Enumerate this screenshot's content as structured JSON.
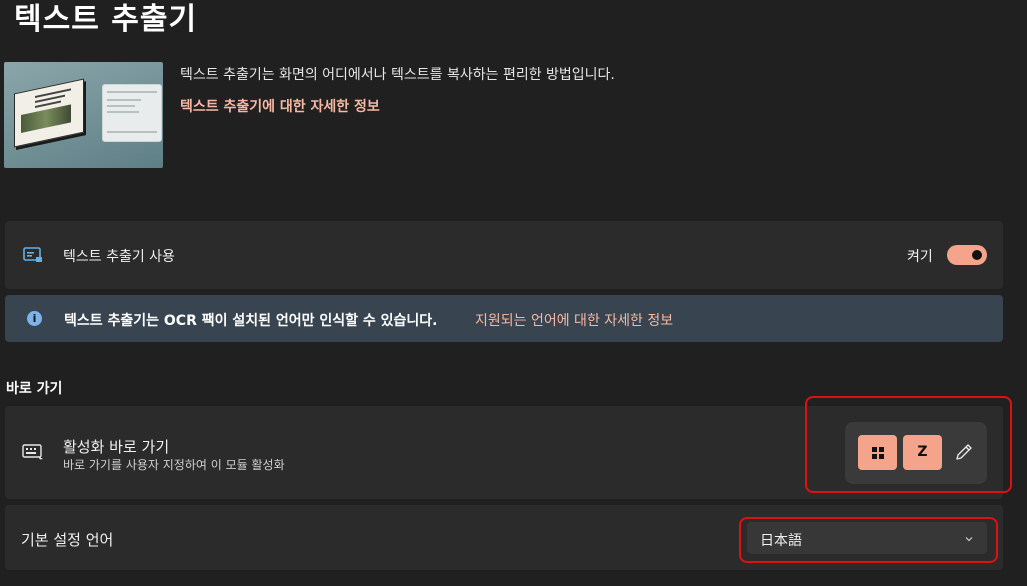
{
  "page": {
    "title": "텍스트 추출기",
    "description": "텍스트 추출기는 화면의 어디에서나 텍스트를 복사하는 편리한 방법입니다.",
    "learn_more_link": "텍스트 추출기에 대한 자세한 정보"
  },
  "enable_card": {
    "icon": "text-extractor-icon",
    "label": "텍스트 추출기 사용",
    "toggle_state_label": "켜기",
    "enabled": true
  },
  "info_bar": {
    "icon": "info-icon",
    "icon_glyph": "i",
    "message": "텍스트 추출기는 OCR 팩이 설치된 언어만 인식할 수 있습니다.",
    "link": "지원되는 언어에 대한 자세한 정보"
  },
  "shortcut_section": {
    "heading": "바로 가기",
    "activation": {
      "icon": "keyboard-icon",
      "label": "활성화 바로 가기",
      "description": "바로 가기를 사용자 지정하여 이 모듈 활성화",
      "keys": [
        "windows-key",
        "Z"
      ],
      "key_z_label": "Z",
      "edit_icon": "pencil-icon"
    }
  },
  "language_card": {
    "label": "기본 설정 언어",
    "selected": "日本語",
    "chevron_icon": "chevron-down-icon"
  },
  "colors": {
    "accent": "#f3a48b",
    "link": "#f6b8a2",
    "background": "#202020",
    "card": "#2b2b2b",
    "info_bar": "#394451",
    "highlight_box": "#e01010"
  }
}
